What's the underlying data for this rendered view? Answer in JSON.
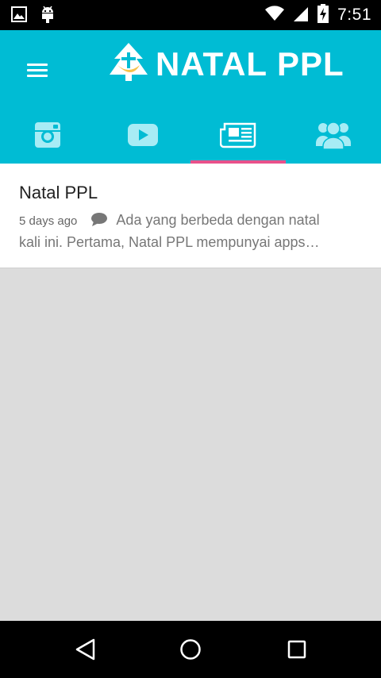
{
  "status_bar": {
    "time": "7:51",
    "icons": [
      "image-icon",
      "android-icon",
      "wifi-icon",
      "signal-icon",
      "battery-charging-icon"
    ]
  },
  "app_bar": {
    "logo_text": "NATAL PPL",
    "menu_icon": "menu-icon",
    "colors": {
      "primary": "#00bcd4",
      "accent": "#e8518a"
    }
  },
  "tabs": [
    {
      "name": "instagram",
      "icon": "instagram-icon",
      "active": false
    },
    {
      "name": "youtube",
      "icon": "youtube-icon",
      "active": false
    },
    {
      "name": "news",
      "icon": "newspaper-icon",
      "active": true
    },
    {
      "name": "community",
      "icon": "people-icon",
      "active": false
    }
  ],
  "posts": [
    {
      "title": "Natal PPL",
      "time": "5 days ago",
      "excerpt_line1": "Ada yang berbeda dengan natal",
      "excerpt_line2": "kali ini. Pertama, Natal PPL mempunyai apps…"
    }
  ],
  "nav_bar": {
    "icons": [
      "back-icon",
      "home-icon",
      "recents-icon"
    ]
  }
}
